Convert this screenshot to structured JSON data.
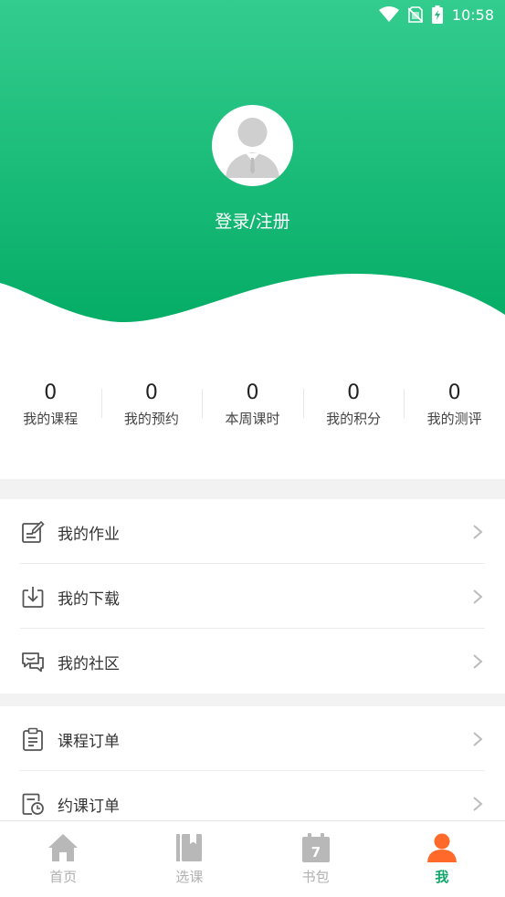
{
  "status_bar": {
    "time": "10:58",
    "icons": [
      "wifi-icon",
      "no-sim-icon",
      "battery-charging-icon"
    ]
  },
  "profile": {
    "login_text": "登录/注册",
    "avatar_icon": "default-avatar-icon"
  },
  "stats": [
    {
      "value": "0",
      "label": "我的课程"
    },
    {
      "value": "0",
      "label": "我的预约"
    },
    {
      "value": "0",
      "label": "本周课时"
    },
    {
      "value": "0",
      "label": "我的积分"
    },
    {
      "value": "0",
      "label": "我的测评"
    }
  ],
  "menu_group_1": [
    {
      "label": "我的作业",
      "icon": "homework-icon"
    },
    {
      "label": "我的下载",
      "icon": "download-icon"
    },
    {
      "label": "我的社区",
      "icon": "community-icon"
    }
  ],
  "menu_group_2": [
    {
      "label": "课程订单",
      "icon": "clipboard-icon"
    },
    {
      "label": "约课订单",
      "icon": "schedule-order-icon"
    }
  ],
  "tabs": [
    {
      "label": "首页",
      "icon": "home-icon",
      "active": false
    },
    {
      "label": "选课",
      "icon": "book-select-icon",
      "active": false
    },
    {
      "label": "书包",
      "icon": "calendar-bag-icon",
      "active": false,
      "badge": "7"
    },
    {
      "label": "我",
      "icon": "user-icon",
      "active": true
    }
  ],
  "colors": {
    "accent": "#12a66a",
    "header_top": "#33cc8f",
    "header_bottom": "#05ad66",
    "active_user_icon": "#ff6a2b"
  }
}
